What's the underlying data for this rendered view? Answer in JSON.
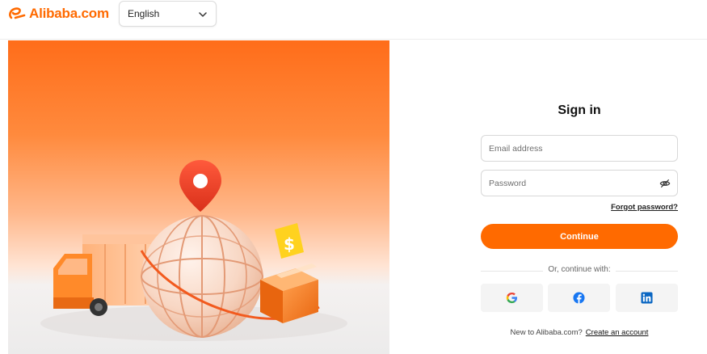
{
  "header": {
    "logo_text": "Alibaba.com",
    "language": "English"
  },
  "form": {
    "title": "Sign in",
    "email_placeholder": "Email address",
    "password_placeholder": "Password",
    "forgot_password": "Forgot password?",
    "continue_label": "Continue",
    "divider_text": "Or, continue with:",
    "social": [
      "google-icon",
      "facebook-icon",
      "linkedin-icon"
    ],
    "new_user_text": "New to Alibaba.com?",
    "create_account": "Create an account"
  },
  "colors": {
    "brand": "#ff6a00",
    "facebook": "#1877f2",
    "linkedin": "#0a66c2"
  }
}
